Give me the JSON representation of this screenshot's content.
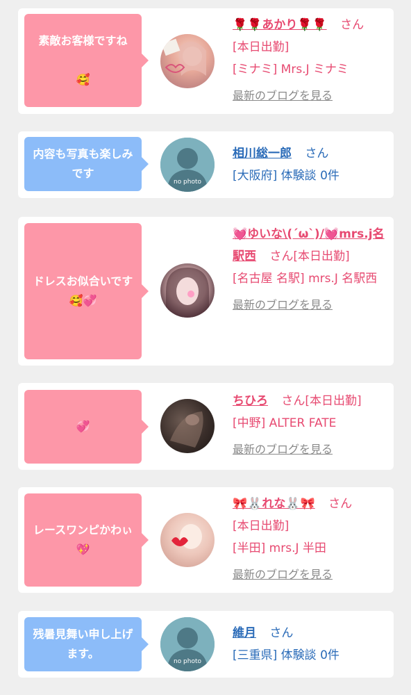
{
  "cards": [
    {
      "message": "素敵お客様ですね",
      "message_emoji": "🥰",
      "name": "🌹🌹あかり🌹🌹",
      "san": "さん",
      "line1": "[本日出勤]",
      "line2": "[ミナミ] Mrs.J ミナミ",
      "blog": "最新のブログを見る"
    },
    {
      "message": "内容も写真も楽しみです",
      "name": "相川総一郎",
      "san": "さん",
      "line1": "[大阪府] 体験談 0件",
      "avatar_label": "no photo"
    },
    {
      "message": "ドレスお似合いです",
      "message_emoji": "🥰💞",
      "name": "💓ゆいな\\(´ω`)/💓mrs.j名駅西",
      "san": "さん[本日出勤]",
      "line2": "[名古屋 名駅] mrs.J 名駅西",
      "blog": "最新のブログを見る"
    },
    {
      "message": "",
      "message_emoji": "💞",
      "name": "ちひろ",
      "san": "さん[本日出勤]",
      "line2": "[中野] ALTER FATE",
      "blog": "最新のブログを見る"
    },
    {
      "message": "レースワンピかわぃ",
      "message_emoji": "💖",
      "name": "🎀🐰れな🐰🎀",
      "san": "さん",
      "line1": "[本日出勤]",
      "line2": "[半田] mrs.J 半田",
      "blog": "最新のブログを見る"
    },
    {
      "message": "残暑見舞い申し上げます。",
      "name": "維月",
      "san": "さん",
      "line1": "[三重県] 体験談 0件",
      "avatar_label": "no photo"
    }
  ],
  "colors": {
    "pink_bubble": "#fd97a8",
    "blue_bubble": "#8cbcf9",
    "pink_text": "#e74a71",
    "blue_text": "#2a6bb8",
    "background": "#efefef"
  }
}
